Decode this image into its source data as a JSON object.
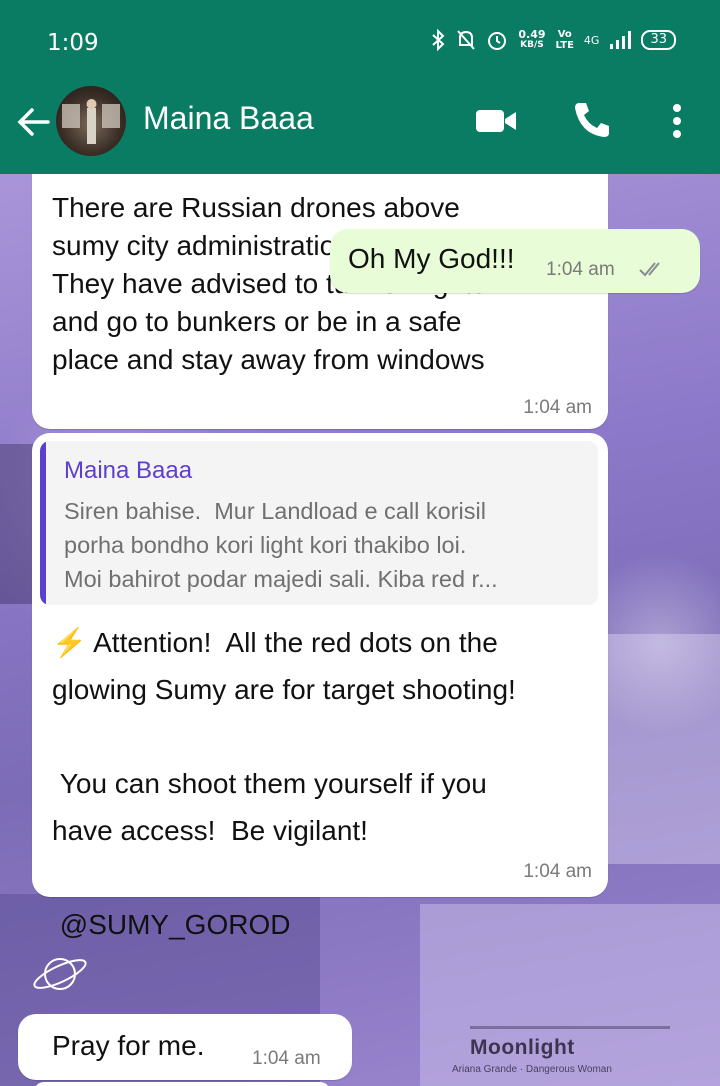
{
  "status_bar": {
    "time": "1:09",
    "net_speed_value": "0.49",
    "net_speed_unit": "KB/S",
    "volte": "Vo\nLTE",
    "network": "4G",
    "battery": "33"
  },
  "header": {
    "contact_name": "Maina Baaa",
    "colors": {
      "header_bg": "#0a7c63",
      "outgoing_bubble": "#e7fcd7",
      "quote_accent": "#5b3fd1"
    }
  },
  "messages": [
    {
      "direction": "incoming",
      "text": "There are Russian drones above\nsumy city administration reports.\nThey have advised to turn off lights\nand go to bunkers or be in a safe\nplace and stay away from windows",
      "time": "1:04 am"
    },
    {
      "direction": "incoming",
      "quote": {
        "author": "Maina Baaa",
        "text": "Siren bahise.  Mur Landload e call korisil\nporha bondho kori light kori thakibo loi.\nMoi bahirot podar majedi sali. Kiba red r..."
      },
      "emoji": "⚡",
      "text": " Attention!  All the red dots on the\nglowing Sumy are for target shooting!\n\n You can shoot them yourself if you\nhave access!  Be vigilant!\n\n @SUMY_GOROD",
      "time": "1:04 am"
    },
    {
      "direction": "outgoing",
      "text": "Oh My God!!!",
      "time": "1:04 am",
      "status": "read"
    },
    {
      "direction": "incoming",
      "text": "Pray for me.",
      "time": "1:04 am"
    }
  ],
  "wallpaper": {
    "song_title": "Moonlight",
    "song_sub": "Ariana Grande · Dangerous Woman"
  }
}
